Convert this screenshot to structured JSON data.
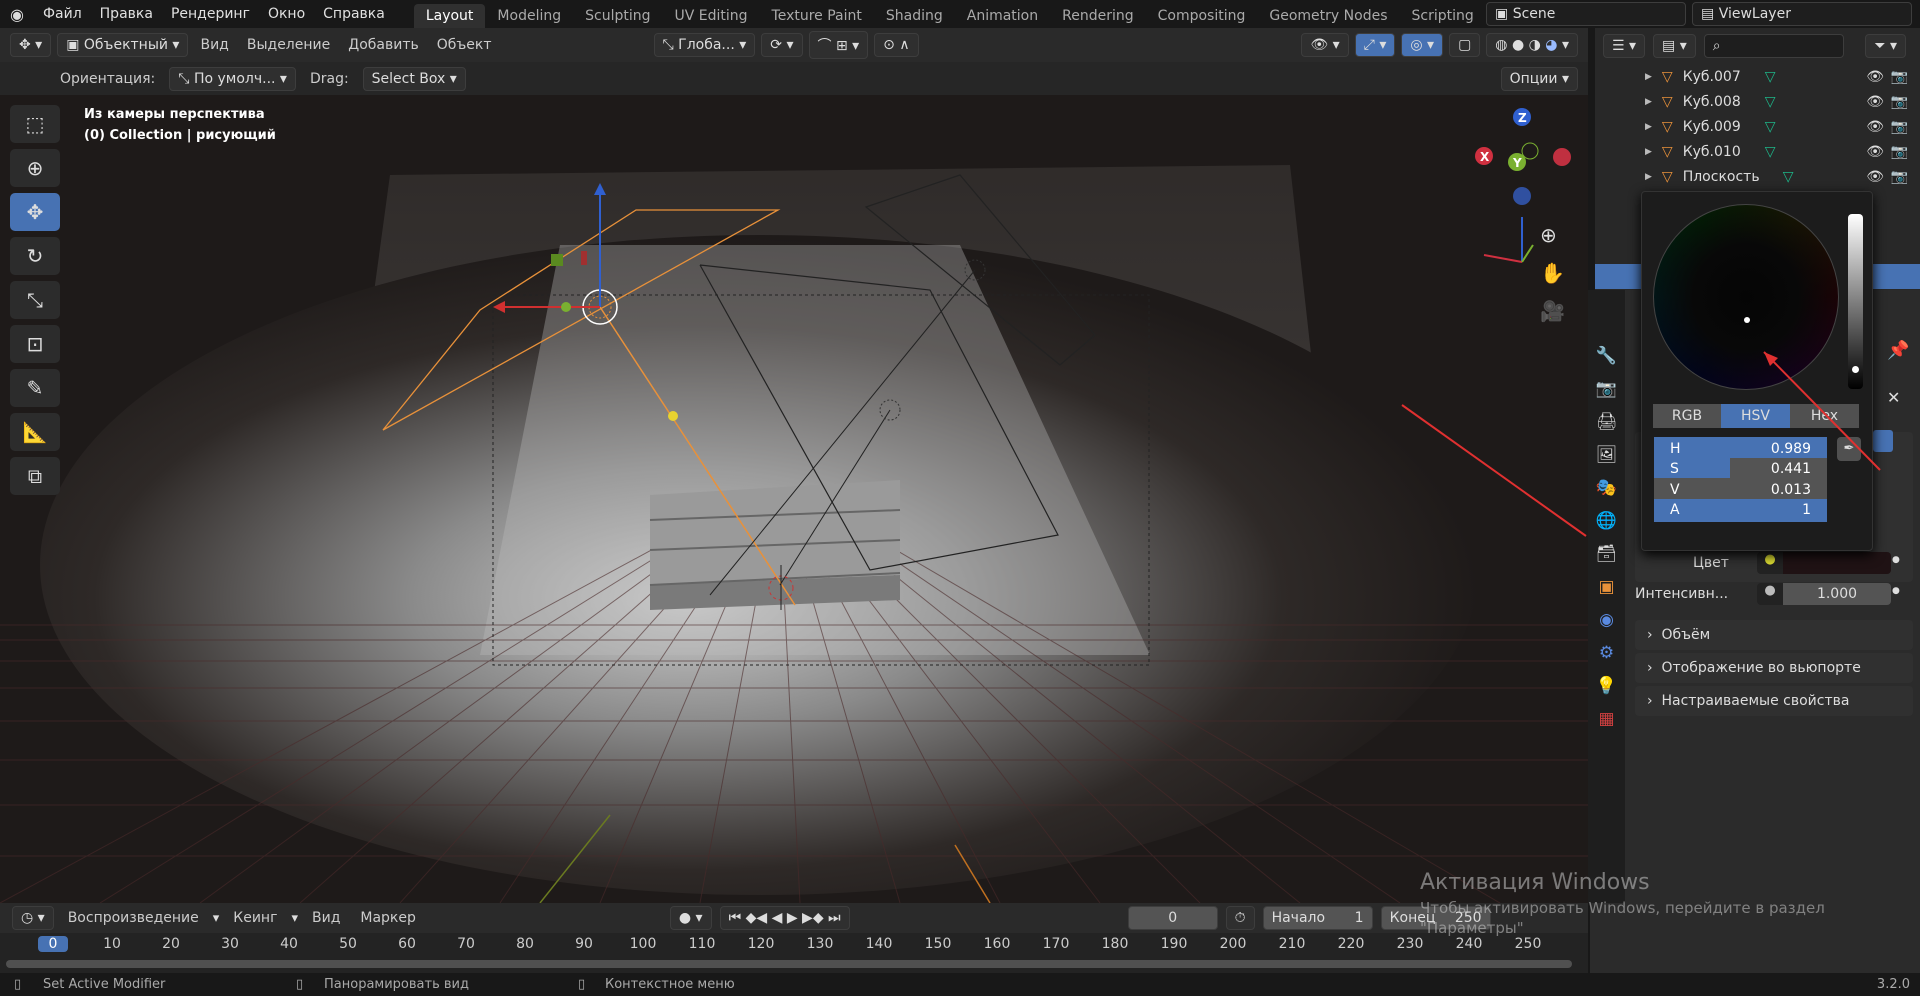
{
  "topbar": {
    "menus": [
      "Файл",
      "Правка",
      "Рендеринг",
      "Окно",
      "Справка"
    ],
    "workspaces": [
      "Layout",
      "Modeling",
      "Sculpting",
      "UV Editing",
      "Texture Paint",
      "Shading",
      "Animation",
      "Rendering",
      "Compositing",
      "Geometry Nodes",
      "Scripting"
    ],
    "active_workspace": "Layout",
    "scene": "Scene",
    "view_layer": "ViewLayer"
  },
  "header": {
    "mode": "Объектный",
    "menus": [
      "Вид",
      "Выделение",
      "Добавить",
      "Объект"
    ],
    "transform_orientation": "Глоба...",
    "orientation_label": "Ориентация:",
    "orientation_value": "По умолч...",
    "drag_label": "Drag:",
    "drag_value": "Select Box",
    "options": "Опции"
  },
  "viewport": {
    "view_name": "Из камеры перспектива",
    "collection": "(0) Collection | рисующий",
    "gizmo_axes": [
      "X",
      "Y",
      "Z"
    ]
  },
  "tools": [
    "select-box",
    "cursor",
    "move",
    "rotate",
    "scale",
    "transform",
    "annotate",
    "measure",
    "add-cube"
  ],
  "outliner": {
    "items": [
      "Куб.007",
      "Куб.008",
      "Куб.009",
      "Куб.010",
      "Плоскость"
    ]
  },
  "color_picker": {
    "modes": [
      "RGB",
      "HSV",
      "Hex"
    ],
    "active_mode": "HSV",
    "fields": [
      {
        "label": "H",
        "value": "0.989",
        "fill": 1
      },
      {
        "label": "S",
        "value": "0.441",
        "fill": 0.441
      },
      {
        "label": "V",
        "value": "0.013",
        "fill": 0
      },
      {
        "label": "A",
        "value": "1",
        "fill": 1
      }
    ]
  },
  "properties": {
    "color_label": "Цвет",
    "color_value": "#1f1214",
    "intensity_label": "Интенсивн...",
    "intensity_value": "1.000",
    "panels": [
      "Объём",
      "Отображение во вьюпорте",
      "Настраиваемые свойства"
    ]
  },
  "timeline": {
    "menus": [
      "Воспроизведение",
      "Кеинг",
      "Вид",
      "Маркер"
    ],
    "current_frame": "0",
    "start_label": "Начало",
    "start": "1",
    "end_label": "Конец",
    "end": "250",
    "ticks": [
      "0",
      "10",
      "20",
      "30",
      "40",
      "50",
      "60",
      "70",
      "80",
      "90",
      "100",
      "110",
      "120",
      "130",
      "140",
      "150",
      "160",
      "170",
      "180",
      "190",
      "200",
      "210",
      "220",
      "230",
      "240",
      "250"
    ]
  },
  "watermark": {
    "title": "Активация Windows",
    "line1": "Чтобы активировать Windows, перейдите в раздел",
    "line2": "\"Параметры\""
  },
  "status": {
    "left": "Set Active Modifier",
    "middle": "Панорамировать вид",
    "right": "Контекстное меню",
    "version": "3.2.0"
  },
  "colors": {
    "accent": "#4772b3",
    "object_orange": "#e8913a",
    "mesh_green": "#1db588"
  }
}
